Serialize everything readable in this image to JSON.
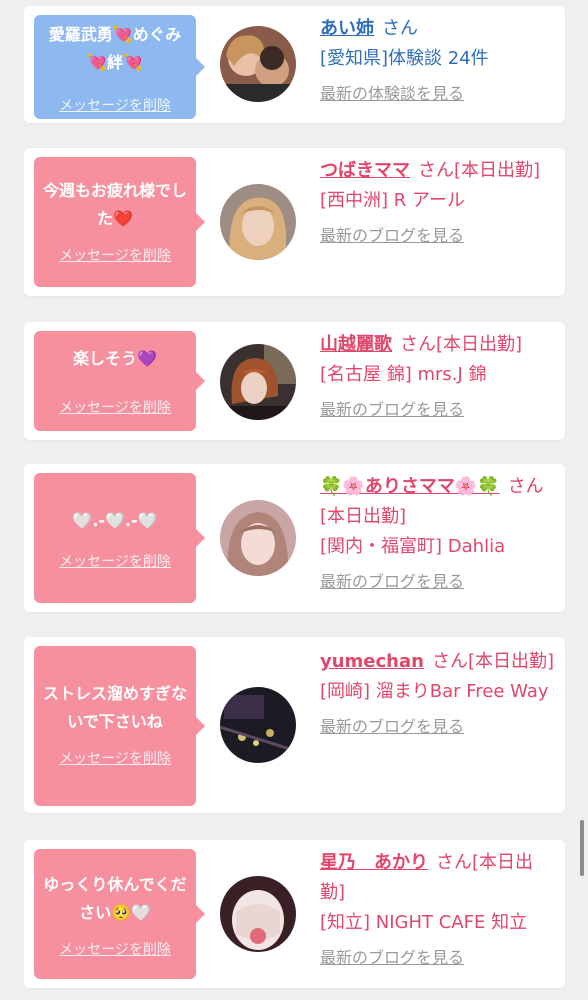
{
  "cards": [
    {
      "message": "愛羅武勇💘めぐみ💘絆💘",
      "delete_label": "メッセージを削除",
      "name": "あい姉",
      "suffix": "さん",
      "store": "[愛知県]体験談 24件",
      "link": "最新の体験談を見る",
      "theme": "blue"
    },
    {
      "message": "今週もお疲れ様でした❤️",
      "delete_label": "メッセージを削除",
      "name": "つばきママ",
      "suffix": "さん[本日出勤]",
      "store": "[西中洲] R アール",
      "link": "最新のブログを見る",
      "theme": "pink"
    },
    {
      "message": "楽しそう💜",
      "delete_label": "メッセージを削除",
      "name": "山越麗歌",
      "suffix": "さん[本日出勤]",
      "store": "[名古屋 錦] mrs.J 錦",
      "link": "最新のブログを見る",
      "theme": "pink"
    },
    {
      "message": "🤍.-🤍.-🤍",
      "delete_label": "メッセージを削除",
      "name": "🍀🌸ありさママ🌸🍀",
      "suffix": "さん[本日出勤]",
      "store": "[関内・福富町] Dahlia",
      "link": "最新のブログを見る",
      "theme": "pink"
    },
    {
      "message": "ストレス溜めすぎないで下さいね",
      "delete_label": "メッセージを削除",
      "name": "yumechan",
      "suffix": "さん[本日出勤]",
      "store": "[岡崎] 溜まりBar Free Way",
      "link": "最新のブログを見る",
      "theme": "pink"
    },
    {
      "message": "ゆっくり休んでください🥺🤍",
      "delete_label": "メッセージを削除",
      "name": "星乃　あかり",
      "suffix": "さん[本日出勤]",
      "store": "[知立] NIGHT CAFE 知立",
      "link": "最新のブログを見る",
      "theme": "pink"
    }
  ]
}
